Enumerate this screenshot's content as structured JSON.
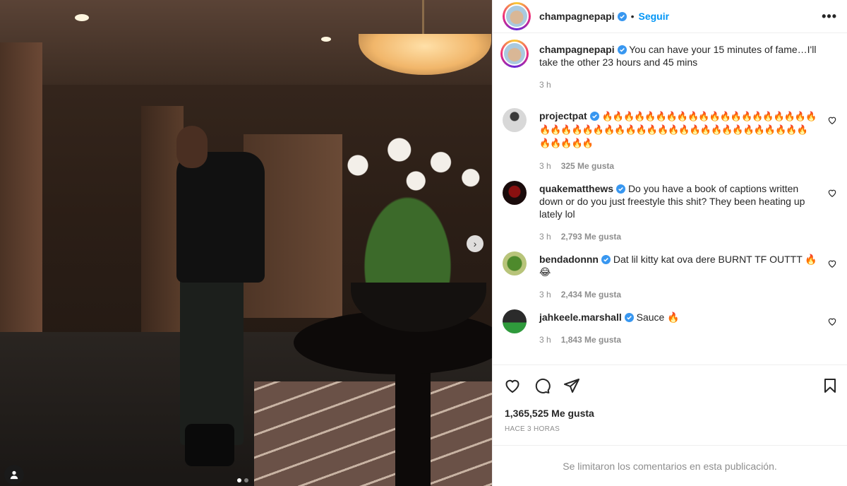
{
  "post": {
    "author": "champagnepapi",
    "follow_label": "Seguir",
    "separator": "•",
    "more_label": "•••",
    "caption": "You can have your 15 minutes of fame…I'll take the other 23 hours and 45 mins",
    "caption_time": "3 h"
  },
  "comments": [
    {
      "username": "projectpat",
      "text": "🔥🔥🔥🔥🔥🔥🔥🔥🔥🔥🔥🔥🔥🔥🔥🔥🔥🔥🔥🔥🔥🔥🔥🔥🔥🔥🔥🔥🔥🔥🔥🔥🔥🔥🔥🔥🔥🔥🔥🔥🔥🔥🔥🔥🔥🔥🔥🔥🔥🔥",
      "time": "3 h",
      "likes": "325 Me gusta"
    },
    {
      "username": "quakematthews",
      "text": "Do you have a book of captions written down or do you just freestyle this shit? They been heating up lately lol",
      "time": "3 h",
      "likes": "2,793 Me gusta"
    },
    {
      "username": "bendadonnn",
      "text": "Dat lil kitty kat ova dere BURNT TF OUTTT 🔥 😂",
      "time": "3 h",
      "likes": "2,434 Me gusta"
    },
    {
      "username": "jahkeele.marshall",
      "text": "Sauce 🔥",
      "time": "3 h",
      "likes": "1,843 Me gusta"
    }
  ],
  "footer": {
    "likes": "1,365,525 Me gusta",
    "posted": "HACE 3 HORAS",
    "comments_disabled": "Se limitaron los comentarios en esta publicación."
  },
  "icons": {
    "like": "heart-icon",
    "comment": "comment-icon",
    "share": "share-icon",
    "save": "bookmark-icon",
    "next": "chevron-right-icon",
    "verified": "verified-badge-icon"
  },
  "colors": {
    "accent": "#0095f6",
    "muted": "#8e8e8e",
    "text": "#262626"
  }
}
